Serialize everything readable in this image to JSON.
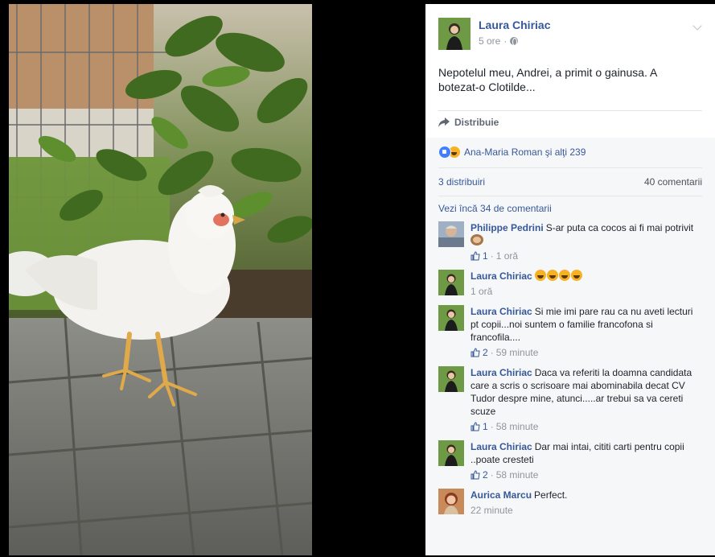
{
  "post": {
    "author": "Laura Chiriac",
    "time": "5 ore",
    "text": "Nepotelul meu, Andrei, a primit o gainusa. A botezat-o Clotilde...",
    "share_label": "Distribuie",
    "reactions_text": "Ana-Maria Roman şi alţi 239",
    "shares_count": "3 distribuiri",
    "comments_count": "40 comentarii",
    "more_comments": "Vezi încă 34 de comentarii"
  },
  "comments": [
    {
      "name": "Philippe Pedrini",
      "text": "S-ar puta ca cocos ai fi mai potrivit",
      "emoji": "monkey",
      "likes": "1",
      "time": "1 oră"
    },
    {
      "name": "Laura Chiriac",
      "text": "",
      "emoji": "haha-x4",
      "likes": "",
      "time": "1 oră"
    },
    {
      "name": "Laura Chiriac",
      "text": "Si mie imi pare rau ca nu aveti lecturi pt copii...noi suntem o familie francofona si francofila....",
      "likes": "2",
      "time": "59 minute"
    },
    {
      "name": "Laura Chiriac",
      "text": "Daca va referiti la doamna candidata care a scris o scrisoare mai abominabila decat CV Tudor despre mine, atunci.....ar trebui sa va cereti scuze",
      "likes": "1",
      "time": "58 minute"
    },
    {
      "name": "Laura Chiriac",
      "text": "Dar mai intai, cititi carti pentru copii ..poate cresteti",
      "likes": "2",
      "time": "58 minute"
    },
    {
      "name": "Aurica Marcu",
      "text": "Perfect.",
      "likes": "",
      "time": "22 minute"
    }
  ],
  "colors": {
    "link": "#365899",
    "meta": "#90949c",
    "like_blue": "#4080ff",
    "haha_yellow": "#f7b125",
    "band": "#f6f7f9"
  },
  "icons": [
    "globe-icon",
    "chevron-down-icon",
    "share-icon",
    "like-icon",
    "haha-icon",
    "thumb-icon",
    "monkey-icon"
  ]
}
